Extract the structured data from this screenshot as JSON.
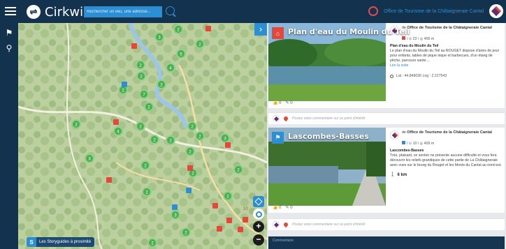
{
  "app": {
    "name": "Cirkwi",
    "search_placeholder": "Rechercher un lieu, une adresse...",
    "owner": "Office de Tourisme de la Châtaigneraie Cantal"
  },
  "colors": {
    "accent": "#2d8fd3",
    "header": "#12324d",
    "poi": "#e5473a",
    "cluster": "#4cae4c"
  },
  "left_rail": {
    "items": [
      "flag-icon",
      "map-pin-icon"
    ]
  },
  "map": {
    "storyguides_badge": "S",
    "storyguides_label": "Les Storyguides à proximité",
    "clusters": [
      "2",
      "3",
      "2",
      "5",
      "2",
      "4",
      "2",
      "2",
      "2",
      "7",
      "2",
      "2",
      "2",
      "4",
      "2",
      "2",
      "2",
      "2",
      "3",
      "2",
      "3",
      "2",
      "2",
      "2",
      "2",
      "2",
      "3",
      "2",
      "2"
    ],
    "warning_badge": "10"
  },
  "cards": [
    {
      "title": "Plan d'eau du Moulin du Teil",
      "by_prefix": "de",
      "by_owner": "Office de Tourisme de la Châtaigneraie Cantal",
      "stats": "/ ⊙ 23 / ◎ 400 m",
      "desc_title": "Plan d'eau du Moulin du Teil",
      "desc": "Le plan d'eau du Moulin du Teil au ROUGET dispose d'aires de jeux pour enfants, tables de pique nique et barbecues, d'un étang de pêche, parcours santé....",
      "read_more": "Lire la suite",
      "latlng": "Lat : 44.849036 Lng : 2.227543",
      "likes": "0",
      "comments": "0",
      "comment_placeholder": "Postez votre commentaire sur ce point d'intérêt"
    },
    {
      "title": "Lascombes-Basses",
      "by_prefix": "de",
      "by_owner": "Office de Tourisme de la Châtaigneraie Cantal",
      "stats": "/ ⊙ 10 / ◎ 409 m",
      "desc_title": "Lascombes-Basses",
      "desc": "Très, plaisant, ce sentier ne présente aucune difficulté et vous fera découvrir les reliefs granitiques de cette partie de La Châtaigneraie avec vues sur le bourg du Rouget et les Monts du Cantal au nord-est.",
      "distance": "6 km",
      "likes": "0",
      "comments": "0",
      "comment_placeholder": "Postez votre commentaire sur ce point d'intérêt"
    }
  ],
  "composer_label": "Commentaire"
}
